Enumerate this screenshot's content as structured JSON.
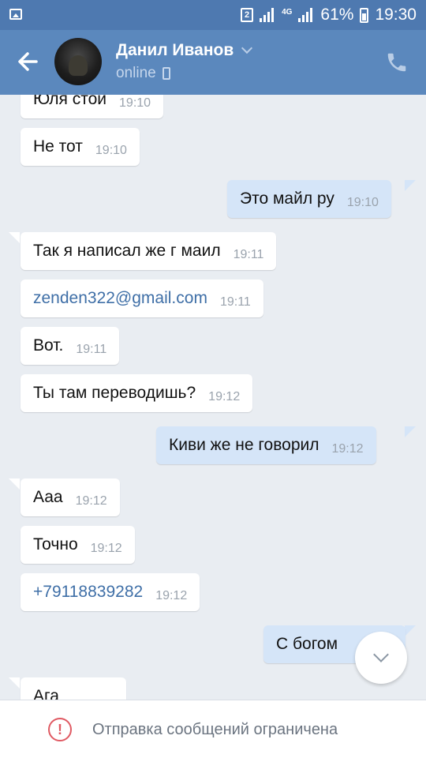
{
  "status_bar": {
    "sim_label": "2",
    "network_label": "4G",
    "battery": "61%",
    "time": "19:30"
  },
  "header": {
    "contact_name": "Данил Иванов",
    "contact_status": "online",
    "colors": {
      "header": "#5b88bd",
      "status_bar": "#4e79b0"
    }
  },
  "messages": [
    {
      "dir": "in",
      "text": "Юля стой",
      "time": "19:10",
      "link": false
    },
    {
      "dir": "in",
      "text": "Не тот",
      "time": "19:10",
      "link": false
    },
    {
      "dir": "out",
      "text": "Это майл ру",
      "time": "19:10",
      "link": false
    },
    {
      "dir": "in",
      "text": "Так я написал же г маил",
      "time": "19:11",
      "link": false
    },
    {
      "dir": "in",
      "text": "zenden322@gmail.com",
      "time": "19:11",
      "link": true
    },
    {
      "dir": "in",
      "text": "Вот.",
      "time": "19:11",
      "link": false
    },
    {
      "dir": "in",
      "text": "Ты там переводишь?",
      "time": "19:12",
      "link": false
    },
    {
      "dir": "out",
      "text": "Киви же не говорил",
      "time": "19:12",
      "link": false
    },
    {
      "dir": "in",
      "text": "Ааа",
      "time": "19:12",
      "link": false
    },
    {
      "dir": "in",
      "text": "Точно",
      "time": "19:12",
      "link": false
    },
    {
      "dir": "in",
      "text": "+79118839282",
      "time": "19:12",
      "link": true
    },
    {
      "dir": "out",
      "text": "С богом",
      "time": "",
      "link": false
    },
    {
      "dir": "in",
      "text": "Ага",
      "time": "",
      "link": false
    }
  ],
  "footer": {
    "notice": "Отправка сообщений ограничена",
    "colors": {
      "warning": "#e05a63"
    }
  }
}
